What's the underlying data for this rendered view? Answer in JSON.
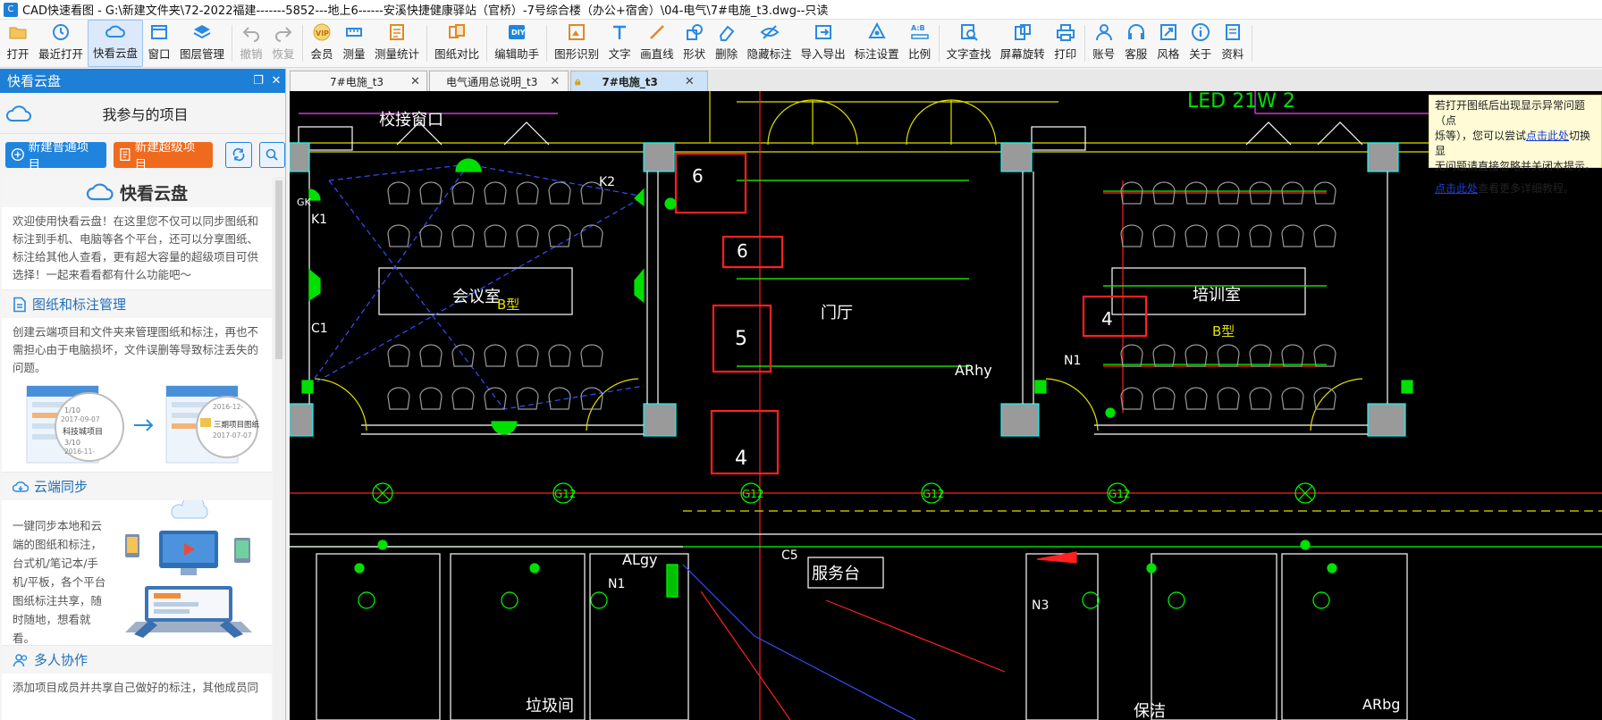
{
  "window": {
    "title": "CAD快速看图 - G:\\新建文件夹\\72-2022福建-------5852---地上6------安溪快捷健康驿站（官桥）-7号综合楼（办公+宿舍）\\04-电气\\7#电施_t3.dwg--只读"
  },
  "toolbar": {
    "items": [
      {
        "label": "打开",
        "icon": "folder-icon"
      },
      {
        "label": "最近打开",
        "icon": "clock-icon"
      },
      {
        "label": "快看云盘",
        "icon": "cloud-icon"
      },
      {
        "label": "窗口",
        "icon": "window-icon"
      },
      {
        "label": "图层管理",
        "icon": "layers-icon"
      },
      {
        "label": "撤销",
        "icon": "undo-icon"
      },
      {
        "label": "恢复",
        "icon": "redo-icon"
      },
      {
        "label": "会员",
        "icon": "vip-icon"
      },
      {
        "label": "测量",
        "icon": "ruler-icon"
      },
      {
        "label": "测量统计",
        "icon": "measure-stat-icon"
      },
      {
        "label": "图纸对比",
        "icon": "compare-icon"
      },
      {
        "label": "编辑助手",
        "icon": "edit-assist-icon"
      },
      {
        "label": "图形识别",
        "icon": "shape-recognize-icon"
      },
      {
        "label": "文字",
        "icon": "text-icon"
      },
      {
        "label": "画直线",
        "icon": "line-icon"
      },
      {
        "label": "形状",
        "icon": "shape-icon"
      },
      {
        "label": "删除",
        "icon": "eraser-icon"
      },
      {
        "label": "隐藏标注",
        "icon": "eye-icon"
      },
      {
        "label": "导入导出",
        "icon": "import-export-icon"
      },
      {
        "label": "标注设置",
        "icon": "annotation-settings-icon"
      },
      {
        "label": "比例",
        "icon": "scale-icon"
      },
      {
        "label": "文字查找",
        "icon": "text-search-icon"
      },
      {
        "label": "屏幕旋转",
        "icon": "rotate-icon"
      },
      {
        "label": "打印",
        "icon": "printer-icon"
      },
      {
        "label": "账号",
        "icon": "user-icon"
      },
      {
        "label": "客服",
        "icon": "headset-icon"
      },
      {
        "label": "风格",
        "icon": "style-icon"
      },
      {
        "label": "关于",
        "icon": "info-icon"
      },
      {
        "label": "资料",
        "icon": "docs-icon"
      }
    ],
    "active": "快看云盘",
    "disabled": [
      "撤销",
      "恢复"
    ]
  },
  "sidebar": {
    "header": "快看云盘",
    "project_title": "我参与的项目",
    "new_project": "新建普通项目",
    "new_super_project": "新建超级项目",
    "intro_title": "快看云盘",
    "intro_text": "欢迎使用快看云盘！在这里您不仅可以同步图纸和标注到手机、电脑等各个平台，还可以分享图纸、标注给其他人查看，更有超大容量的超级项目可供选择！一起来看看都有什么功能吧～",
    "sections": [
      {
        "title": "图纸和标注管理",
        "text": "创建云端项目和文件夹来管理图纸和标注，再也不需担心由于电脑损坏，文件误删等导致标注丢失的问题。"
      },
      {
        "title": "云端同步",
        "text": "一键同步本地和云端的图纸和标注，台式机/笔记本/手机/平板，各个平台图纸标注共享，随时随地，想看就看。"
      },
      {
        "title": "多人协作",
        "text": "添加项目成员并共享自己做好的标注，其他成员同"
      }
    ],
    "illustration": {
      "left_date1": "2017-09-07",
      "left_count1": "1/10",
      "left_project": "科技城项目",
      "left_count2": "3/10",
      "left_date2": "2016-11-",
      "right_date1": "2016-12-",
      "right_project": "三期项目图纸",
      "right_date2": "2017-07-07"
    }
  },
  "tabs": [
    {
      "label": "7#电施_t3",
      "active": false
    },
    {
      "label": "电气通用总说明_t3",
      "active": false
    },
    {
      "label": "7#电施_t3",
      "active": true,
      "locked": true
    }
  ],
  "tip": {
    "line1": "若打开图纸后出现显示异常问题（点",
    "line2_pre": "烁等），您可以尝试",
    "line2_link": "点击此处",
    "line2_post": "切换显",
    "line3": "无问题请直接忽略并关闭本提示。",
    "line4_link": "点击此处",
    "line4_post": "查看更多详细教程。"
  },
  "drawing": {
    "labels": {
      "window": "校接窗口",
      "meeting": "会议室",
      "btype": "B型",
      "training": "培训室",
      "hall": "门厅",
      "service": "服务台",
      "garbage": "垃圾间",
      "cleaning": "保洁",
      "led": "LED 21W 2",
      "arhy": "ARhy",
      "algy": "ALgy",
      "arbg": "ARbg",
      "k1": "K1",
      "k2": "K2",
      "c1": "C1",
      "c5": "C5",
      "n1a": "N1",
      "n1b": "N1",
      "n3": "N3",
      "gk": "GK",
      "g12": "G12",
      "n6a": "6",
      "n6b": "6",
      "n5": "5",
      "n4a": "4",
      "n4b": "4"
    }
  }
}
